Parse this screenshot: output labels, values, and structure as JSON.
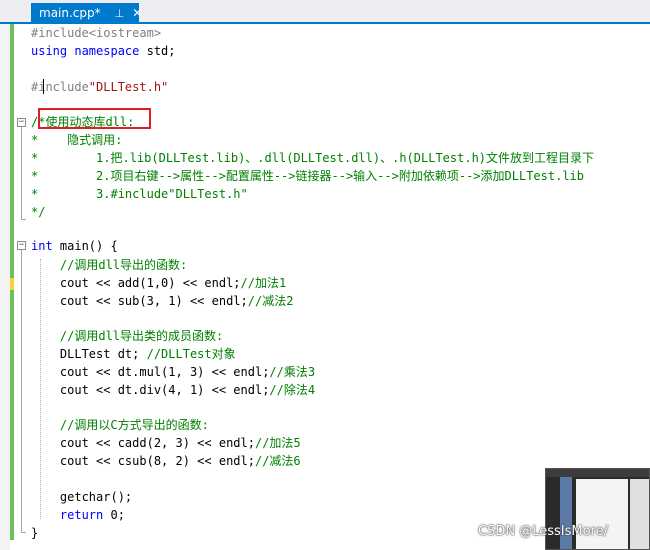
{
  "tab": {
    "label": "main.cpp*",
    "pin_glyph": "⊥",
    "close_glyph": "✕"
  },
  "code_lines": [
    {
      "cls": "pp",
      "text": "#include<iostream>"
    },
    {
      "cls": "kw",
      "text": "using namespace",
      "rest": " std;"
    },
    {
      "cls": "pp",
      "text": "#include",
      "str": "\"DLLTest.h\""
    },
    {
      "cls": "cm",
      "text": "/*使用动态库dll:"
    },
    {
      "cls": "cm",
      "text": "*    隐式调用:"
    },
    {
      "cls": "cm",
      "text": "*        1.把.lib(DLLTest.lib)、.dll(DLLTest.dll)、.h(DLLTest.h)文件放到工程目录下"
    },
    {
      "cls": "cm",
      "text": "*        2.项目右键-->属性-->配置属性-->链接器-->输入-->附加依赖项-->添加DLLTest.lib"
    },
    {
      "cls": "cm",
      "text": "*        3.#include\"DLLTest.h\""
    },
    {
      "cls": "cm",
      "text": "*/"
    },
    {
      "text": "int main() {"
    },
    {
      "cls": "cm",
      "text": "    //调用dll导出的函数:"
    },
    {
      "text": "    cout << add(1,0) << endl;",
      "comment": "//加法1"
    },
    {
      "text": "    cout << sub(3, 1) << endl;",
      "comment": "//减法2"
    },
    {
      "cls": "cm",
      "text": "    //调用dll导出类的成员函数:"
    },
    {
      "text": "    DLLTest dt;",
      "comment": " //DLLTest对象"
    },
    {
      "text": "    cout << dt.mul(1, 3) << endl;",
      "comment": "//乘法3"
    },
    {
      "text": "    cout << dt.div(4, 1) << endl;",
      "comment": "//除法4"
    },
    {
      "cls": "cm",
      "text": "    //调用以C方式导出的函数:"
    },
    {
      "text": "    cout << cadd(2, 3) << endl;",
      "comment": "//加法5"
    },
    {
      "text": "    cout << csub(8, 2) << endl;",
      "comment": "//减法6"
    },
    {
      "text": "    getchar();"
    },
    {
      "kwtext": "    return",
      "rest": " 0;"
    },
    {
      "text": "}"
    }
  ],
  "fold_glyph": "−",
  "watermark": "CSDN @LessIsMore/",
  "colors": {
    "keyword": "#0000ff",
    "comment": "#008000",
    "string": "#a31515",
    "tab_accent": "#007acc",
    "highlight_box": "#e02020"
  }
}
